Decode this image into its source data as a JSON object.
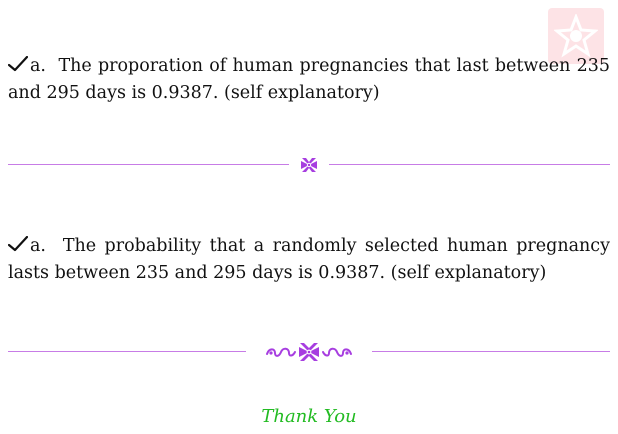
{
  "colors": {
    "ornament": "#a73ee0",
    "rule": "#c77ce6",
    "thanks": "#22bb22",
    "logo_bg": "#fde3e6",
    "logo_fg": "#ffffff"
  },
  "icons": {
    "check": "checkmark-icon",
    "ornament_small": "floral-ornament-icon",
    "ornament_large": "floral-flourish-icon",
    "logo": "star-logo-icon"
  },
  "answers": [
    {
      "label": "a.",
      "text": "The proporation of human pregnancies that last between 235 and 295 days is 0.9387. (self explanatory)"
    },
    {
      "label": "a.",
      "text": "The probability that a randomly selected human pregnancy lasts between 235 and 295 days is 0.9387. (self explanatory)"
    }
  ],
  "closing": "Thank You"
}
